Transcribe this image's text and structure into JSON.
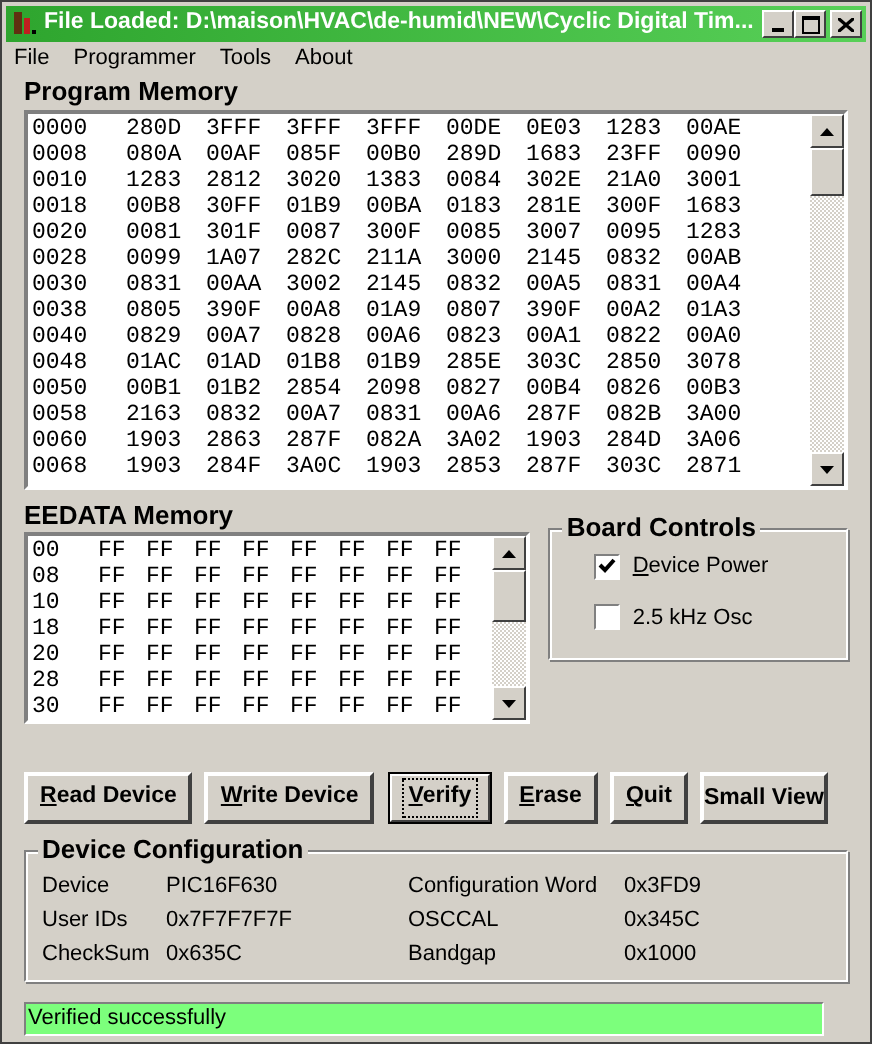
{
  "window": {
    "title": "File Loaded: D:\\maison\\HVAC\\de-humid\\NEW\\Cyclic Digital Tim..."
  },
  "menu": [
    "File",
    "Programmer",
    "Tools",
    "About"
  ],
  "program_memory": {
    "label": "Program Memory",
    "rows": [
      {
        "address": "0000",
        "words": [
          "280D",
          "3FFF",
          "3FFF",
          "3FFF",
          "00DE",
          "0E03",
          "1283",
          "00AE"
        ]
      },
      {
        "address": "0008",
        "words": [
          "080A",
          "00AF",
          "085F",
          "00B0",
          "289D",
          "1683",
          "23FF",
          "0090"
        ]
      },
      {
        "address": "0010",
        "words": [
          "1283",
          "2812",
          "3020",
          "1383",
          "0084",
          "302E",
          "21A0",
          "3001"
        ]
      },
      {
        "address": "0018",
        "words": [
          "00B8",
          "30FF",
          "01B9",
          "00BA",
          "0183",
          "281E",
          "300F",
          "1683"
        ]
      },
      {
        "address": "0020",
        "words": [
          "0081",
          "301F",
          "0087",
          "300F",
          "0085",
          "3007",
          "0095",
          "1283"
        ]
      },
      {
        "address": "0028",
        "words": [
          "0099",
          "1A07",
          "282C",
          "211A",
          "3000",
          "2145",
          "0832",
          "00AB"
        ]
      },
      {
        "address": "0030",
        "words": [
          "0831",
          "00AA",
          "3002",
          "2145",
          "0832",
          "00A5",
          "0831",
          "00A4"
        ]
      },
      {
        "address": "0038",
        "words": [
          "0805",
          "390F",
          "00A8",
          "01A9",
          "0807",
          "390F",
          "00A2",
          "01A3"
        ]
      },
      {
        "address": "0040",
        "words": [
          "0829",
          "00A7",
          "0828",
          "00A6",
          "0823",
          "00A1",
          "0822",
          "00A0"
        ]
      },
      {
        "address": "0048",
        "words": [
          "01AC",
          "01AD",
          "01B8",
          "01B9",
          "285E",
          "303C",
          "2850",
          "3078"
        ]
      },
      {
        "address": "0050",
        "words": [
          "00B1",
          "01B2",
          "2854",
          "2098",
          "0827",
          "00B4",
          "0826",
          "00B3"
        ]
      },
      {
        "address": "0058",
        "words": [
          "2163",
          "0832",
          "00A7",
          "0831",
          "00A6",
          "287F",
          "082B",
          "3A00"
        ]
      },
      {
        "address": "0060",
        "words": [
          "1903",
          "2863",
          "287F",
          "082A",
          "3A02",
          "1903",
          "284D",
          "3A06"
        ]
      },
      {
        "address": "0068",
        "words": [
          "1903",
          "284F",
          "3A0C",
          "1903",
          "2853",
          "287F",
          "303C",
          "2871"
        ]
      }
    ]
  },
  "eedata_memory": {
    "label": "EEDATA Memory",
    "rows": [
      {
        "address": "00",
        "bytes": [
          "FF",
          "FF",
          "FF",
          "FF",
          "FF",
          "FF",
          "FF",
          "FF"
        ]
      },
      {
        "address": "08",
        "bytes": [
          "FF",
          "FF",
          "FF",
          "FF",
          "FF",
          "FF",
          "FF",
          "FF"
        ]
      },
      {
        "address": "10",
        "bytes": [
          "FF",
          "FF",
          "FF",
          "FF",
          "FF",
          "FF",
          "FF",
          "FF"
        ]
      },
      {
        "address": "18",
        "bytes": [
          "FF",
          "FF",
          "FF",
          "FF",
          "FF",
          "FF",
          "FF",
          "FF"
        ]
      },
      {
        "address": "20",
        "bytes": [
          "FF",
          "FF",
          "FF",
          "FF",
          "FF",
          "FF",
          "FF",
          "FF"
        ]
      },
      {
        "address": "28",
        "bytes": [
          "FF",
          "FF",
          "FF",
          "FF",
          "FF",
          "FF",
          "FF",
          "FF"
        ]
      },
      {
        "address": "30",
        "bytes": [
          "FF",
          "FF",
          "FF",
          "FF",
          "FF",
          "FF",
          "FF",
          "FF"
        ]
      }
    ]
  },
  "board_controls": {
    "title": "Board Controls",
    "items": [
      {
        "label": "Device Power",
        "checked": true,
        "underline_first": true
      },
      {
        "label": "2.5 kHz Osc",
        "checked": false,
        "underline_first": false
      }
    ]
  },
  "buttons": [
    {
      "label": "Read Device",
      "underline_first": true,
      "focused": false
    },
    {
      "label": "Write Device",
      "underline_first": true,
      "focused": false
    },
    {
      "label": "Verify",
      "underline_first": true,
      "focused": true
    },
    {
      "label": "Erase",
      "underline_first": true,
      "focused": false
    },
    {
      "label": "Quit",
      "underline_first": true,
      "focused": false
    },
    {
      "label": "Small View",
      "underline_first": false,
      "focused": false
    }
  ],
  "device_configuration": {
    "title": "Device Configuration",
    "left": [
      {
        "label": "Device",
        "value": "PIC16F630"
      },
      {
        "label": "User IDs",
        "value": "0x7F7F7F7F"
      },
      {
        "label": "CheckSum",
        "value": "0x635C"
      }
    ],
    "right": [
      {
        "label": "Configuration Word",
        "value": "0x3FD9"
      },
      {
        "label": "OSCCAL",
        "value": "0x345C"
      },
      {
        "label": "Bandgap",
        "value": "0x1000"
      }
    ]
  },
  "status_bar": {
    "text": "Verified successfully"
  }
}
